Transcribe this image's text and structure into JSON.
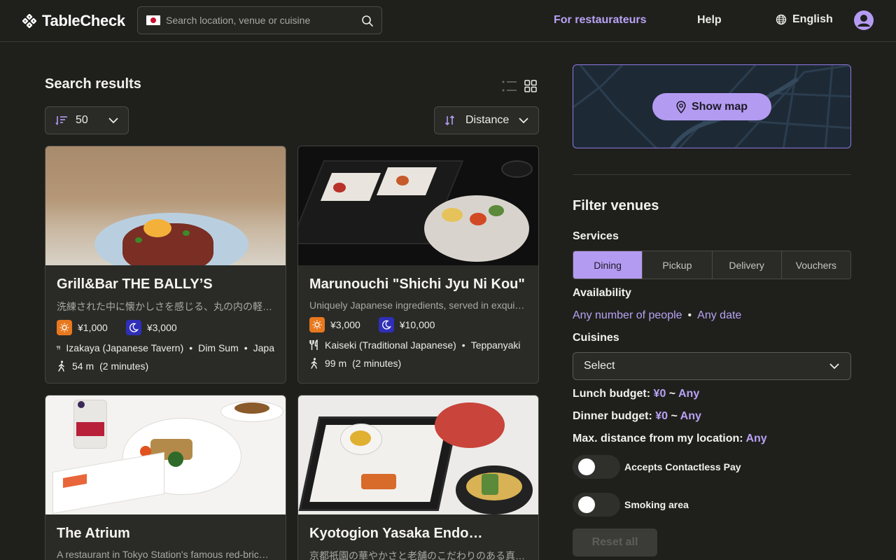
{
  "header": {
    "logo_text": "TableCheck",
    "search_placeholder": "Search location, venue or cuisine",
    "for_restaurateurs": "For restaurateurs",
    "help": "Help",
    "language": "English"
  },
  "results": {
    "title": "Search results",
    "per_page": "50",
    "sort": "Distance"
  },
  "venues": [
    {
      "name": "Grill&Bar THE BALLY’S",
      "description": "洗練された中に懐かしさを感じる、丸の内の軽…",
      "lunch_price": "¥1,000",
      "dinner_price": "¥3,000",
      "cuisines": [
        "Izakaya (Japanese Tavern)",
        "Dim Sum",
        "Japa"
      ],
      "distance": "54 m",
      "walk_time": "(2 minutes)"
    },
    {
      "name": "Marunouchi \"Shichi Jyu Ni Kou\"",
      "description": "Uniquely Japanese ingredients, served in exqui…",
      "lunch_price": "¥3,000",
      "dinner_price": "¥10,000",
      "cuisines": [
        "Kaiseki (Traditional Japanese)",
        "Teppanyaki"
      ],
      "distance": "99 m",
      "walk_time": "(2 minutes)"
    },
    {
      "name": "The Atrium",
      "description": "A restaurant in Tokyo Station's famous red-bric…"
    },
    {
      "name": "Kyotogion Yasaka Endo…",
      "description": "京都祇園の華やかさと老舗のこだわりのある真…"
    }
  ],
  "map": {
    "button": "Show map"
  },
  "filters": {
    "title": "Filter venues",
    "services_label": "Services",
    "services": [
      "Dining",
      "Pickup",
      "Delivery",
      "Vouchers"
    ],
    "availability_label": "Availability",
    "people": "Any number of people",
    "date": "Any date",
    "cuisines_label": "Cuisines",
    "cuisines_value": "Select",
    "lunch_label": "Lunch budget:",
    "lunch_min": "¥0",
    "lunch_max": "Any",
    "dinner_label": "Dinner budget:",
    "dinner_min": "¥0",
    "dinner_max": "Any",
    "distance_label": "Max. distance from my location:",
    "distance_value": "Any",
    "contactless": "Accepts Contactless Pay",
    "smoking": "Smoking area",
    "reset": "Reset all"
  },
  "colors": {
    "accent": "#b49bf2",
    "background": "#1f201c",
    "card": "#2a2b27",
    "lunch_badge": "#e8781e",
    "dinner_badge": "#2f2fb8"
  }
}
